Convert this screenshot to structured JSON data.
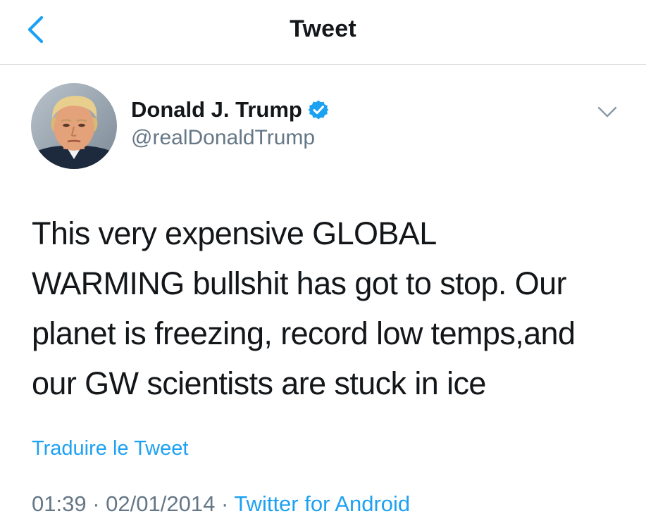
{
  "header": {
    "title": "Tweet",
    "back_icon": "chevron-left-icon"
  },
  "author": {
    "name": "Donald J. Trump",
    "handle": "@realDonaldTrump",
    "verified": true,
    "verified_icon": "verified-badge-icon"
  },
  "tweet": {
    "text": "This very expensive GLOBAL\nWARMING bullshit has got to stop. Our\nplanet is freezing, record low temps,and\nour GW scientists are stuck in ice",
    "translate_label": "Traduire le Tweet",
    "time": "01:39",
    "date": "02/01/2014",
    "separator": "·",
    "source": "Twitter for Android",
    "menu_icon": "chevron-down-icon"
  },
  "colors": {
    "accent": "#1da1f2",
    "text": "#14171a",
    "secondary": "#657786",
    "divider": "#dcdfe3"
  }
}
